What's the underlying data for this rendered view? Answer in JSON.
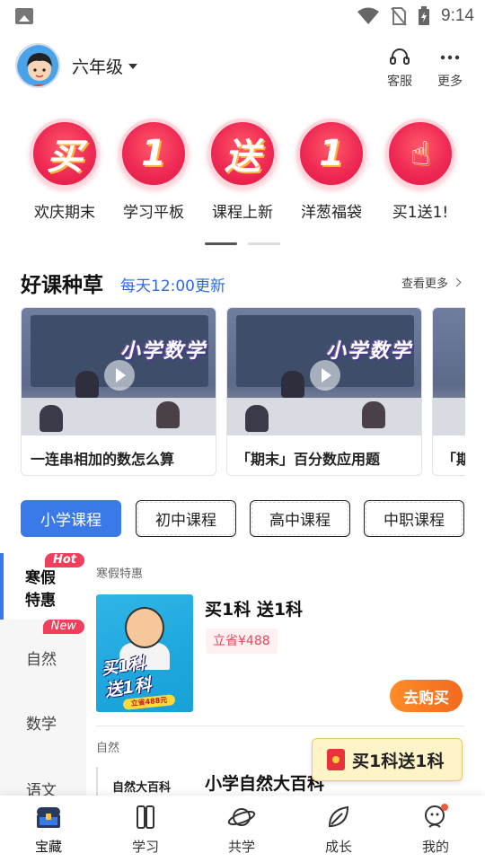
{
  "status_bar": {
    "time": "9:14"
  },
  "header": {
    "grade": "六年级",
    "service_label": "客服",
    "more_label": "更多"
  },
  "promos": [
    {
      "glyph": "买",
      "label": "欢庆期末"
    },
    {
      "glyph": "1",
      "label": "学习平板"
    },
    {
      "glyph": "送",
      "label": "课程上新"
    },
    {
      "glyph": "1",
      "label": "洋葱福袋"
    },
    {
      "glyph": "☝",
      "label": "买1送1!"
    }
  ],
  "good_courses": {
    "title": "好课种草",
    "subtitle": "每天12:00更新",
    "more": "查看更多",
    "cards": [
      {
        "thumb_title": "小学数学",
        "caption": "一连串相加的数怎么算"
      },
      {
        "thumb_title": "小学数学",
        "caption": "「期末」百分数应用题"
      },
      {
        "thumb_title": "",
        "caption": "「期"
      }
    ]
  },
  "tabs": [
    {
      "label": "小学课程",
      "active": true
    },
    {
      "label": "初中课程",
      "active": false
    },
    {
      "label": "高中课程",
      "active": false
    },
    {
      "label": "中职课程",
      "active": false
    }
  ],
  "left_nav": {
    "items": [
      {
        "label": "寒假特惠",
        "badge": "Hot",
        "active": true
      },
      {
        "label": "自然",
        "badge": "New",
        "active": false
      },
      {
        "label": "数学",
        "badge": "",
        "active": false
      },
      {
        "label": "语文",
        "badge": "",
        "active": false
      }
    ]
  },
  "content": {
    "section1_label": "寒假特惠",
    "product1": {
      "title": "买1科 送1科",
      "tag": "立省¥488",
      "button": "去购买",
      "img_line1": "买1科",
      "img_line2": "送1科",
      "img_line3": "立省488元"
    },
    "section2_label": "自然",
    "product2": {
      "img_text": "自然大百科",
      "title": "小学自然大百科"
    }
  },
  "float_promo": {
    "label": "买1科送1科"
  },
  "bottom_nav": [
    {
      "label": "宝藏",
      "icon": "treasure-chest-icon",
      "active": true
    },
    {
      "label": "学习",
      "icon": "book-icon",
      "active": false
    },
    {
      "label": "共学",
      "icon": "planet-icon",
      "active": false
    },
    {
      "label": "成长",
      "icon": "leaf-icon",
      "active": false
    },
    {
      "label": "我的",
      "icon": "profile-icon",
      "active": false
    }
  ],
  "colors": {
    "primary_blue": "#3a7ae8",
    "promo_red": "#ef2a54",
    "buy_orange": "#f36a1e",
    "badge_red": "#f03e5c"
  }
}
